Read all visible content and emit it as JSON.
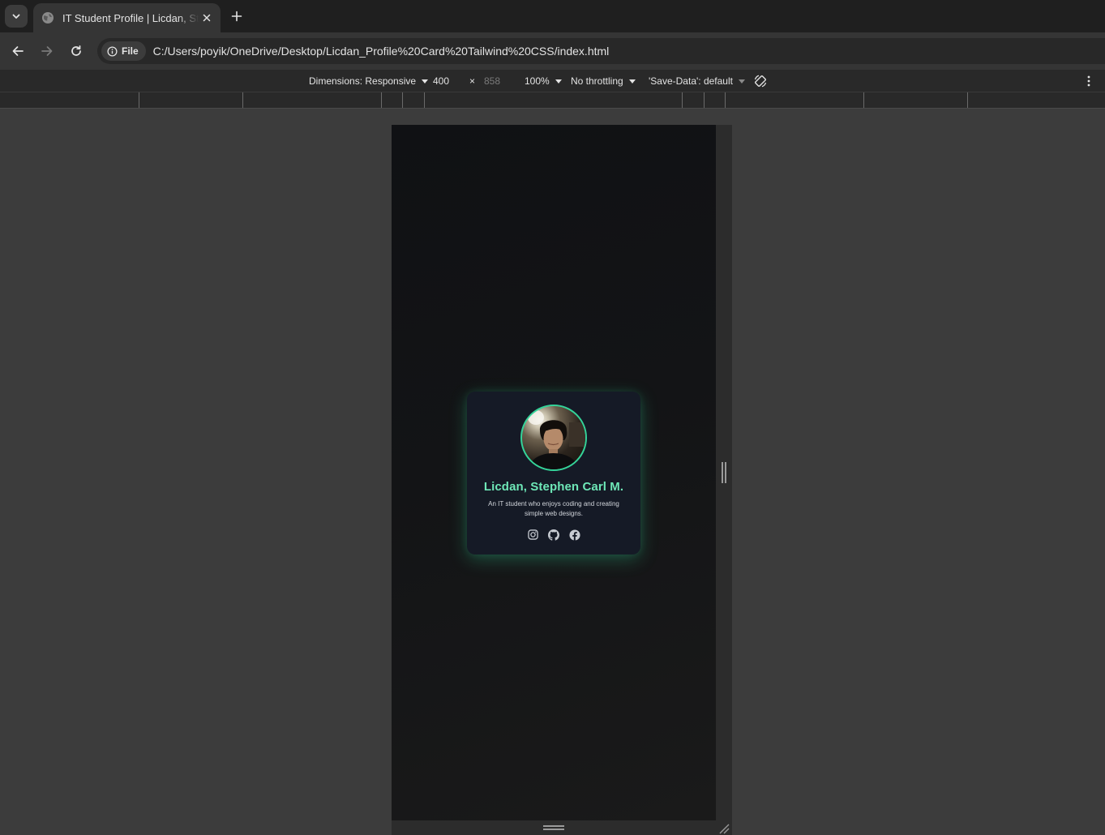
{
  "browser": {
    "tab_title": "IT Student Profile | Licdan, Stephen Carl M.",
    "site_chip_label": "File",
    "url": "C:/Users/poyik/OneDrive/Desktop/Licdan_Profile%20Card%20Tailwind%20CSS/index.html"
  },
  "devtools": {
    "dimensions_label": "Dimensions: Responsive",
    "width": "400",
    "times": "×",
    "height": "858",
    "zoom": "100%",
    "throttling": "No throttling",
    "save_data": "'Save-Data': default"
  },
  "card": {
    "name": "Licdan, Stephen Carl M.",
    "bio": "An IT student who enjoys coding and creating simple web designs.",
    "socials": [
      "instagram-icon",
      "github-icon",
      "facebook-icon"
    ]
  },
  "colors": {
    "accent": "#34d399",
    "name_text": "#6ee7b7",
    "card_bg": "#151a26"
  }
}
